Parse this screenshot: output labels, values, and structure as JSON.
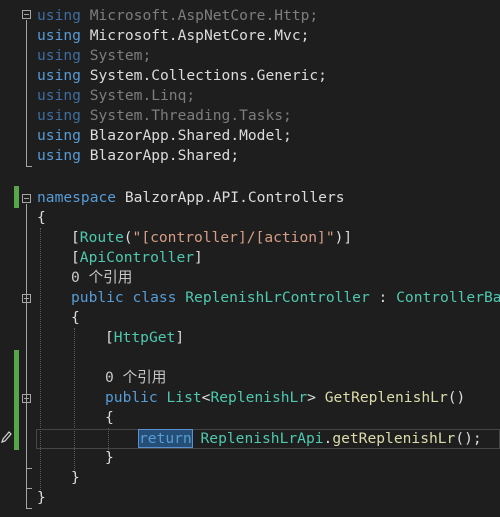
{
  "usings": [
    {
      "kw": "using",
      "ns": "Microsoft.AspNetCore.Http;",
      "dimmed": true
    },
    {
      "kw": "using",
      "ns": "Microsoft.AspNetCore.Mvc;",
      "dimmed": false
    },
    {
      "kw": "using",
      "ns": "System;",
      "dimmed": true
    },
    {
      "kw": "using",
      "ns": "System.Collections.Generic;",
      "dimmed": false
    },
    {
      "kw": "using",
      "ns": "System.Linq;",
      "dimmed": true
    },
    {
      "kw": "using",
      "ns": "System.Threading.Tasks;",
      "dimmed": true
    },
    {
      "kw": "using",
      "ns": "BlazorApp.Shared.Model;",
      "dimmed": false
    },
    {
      "kw": "using",
      "ns": "BlazorApp.Shared;",
      "dimmed": false
    }
  ],
  "namespace_line": {
    "kw": "namespace",
    "name": " BalzorApp.API.Controllers"
  },
  "open_brace": "{",
  "close_brace": "}",
  "route_attr": {
    "open": "[",
    "name": "Route",
    "paren_open": "(",
    "value": "\"[controller]/[action]\"",
    "paren_close": ")]"
  },
  "api_attr": {
    "open": "[",
    "name": "ApiController",
    "close": "]"
  },
  "refs_label": "0 个引用",
  "class_line": {
    "kw1": "public",
    "kw2": "class",
    "name": "ReplenishLrController",
    "sep": " : ",
    "base": "ControllerBase"
  },
  "httpget_attr": {
    "open": "[",
    "name": "HttpGet",
    "close": "]"
  },
  "method_line": {
    "kw": "public",
    "type1": "List",
    "lt": "<",
    "type2": "ReplenishLr",
    "gt": ">",
    "name": "GetReplenishLr",
    "parens": "()"
  },
  "return_line": {
    "kw": "return",
    "cls": "ReplenishLrApi",
    "dot": ".",
    "call": "getReplenishLr",
    "rest": "();"
  },
  "icons": {
    "fold": "collapse-box",
    "edit": "pencil"
  },
  "colors": {
    "background": "#1e1e1e",
    "keyword": "#569cd6",
    "type": "#4ec9b0",
    "string": "#d69d85",
    "method": "#dcdcaa",
    "text": "#dcdcdc",
    "changed_margin": "#57a64a"
  }
}
